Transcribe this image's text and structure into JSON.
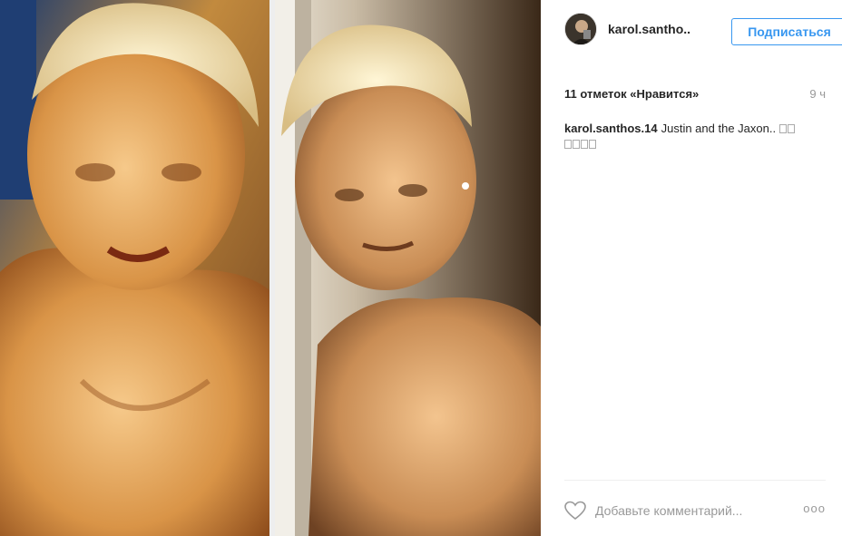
{
  "post": {
    "photo": {
      "description_icon": "photo"
    }
  },
  "header": {
    "username": "karol.santho..",
    "follow_label": "Подписаться"
  },
  "stats": {
    "likes": "11 отметок «Нравится»",
    "time": "9 ч"
  },
  "caption": {
    "username": "karol.santhos.14",
    "text": "Justin and the Jaxon.."
  },
  "comment": {
    "placeholder": "Добавьте комментарий...",
    "more": "ooo"
  },
  "colors": {
    "accent": "#3897f0",
    "muted": "#999999",
    "text": "#262626"
  }
}
